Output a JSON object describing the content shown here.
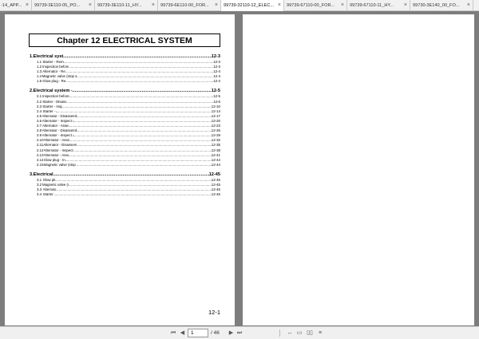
{
  "tabs": [
    {
      "label": "-14_APP...",
      "active": false
    },
    {
      "label": "99739-3E110-05_PO...",
      "active": false
    },
    {
      "label": "99739-3E110-11_HY...",
      "active": false
    },
    {
      "label": "99739-6E110-00_FOR...",
      "active": false
    },
    {
      "label": "99739-32110-12_ELEC...",
      "active": true
    },
    {
      "label": "99739-67110-00_FOR...",
      "active": false
    },
    {
      "label": "99739-67110-11_HY...",
      "active": false
    },
    {
      "label": "99730-3E140_00_FO...",
      "active": false
    }
  ],
  "tab_close_icon": "×",
  "document": {
    "chapter_title": "Chapter 12  ELECTRICAL SYSTEM",
    "footer_page": "12-1",
    "sections": [
      {
        "num": "1.",
        "title": "Electrical system - Remove and Inspect",
        "page": "12-3",
        "items": [
          {
            "num": "1.1",
            "title": "Starter - Remove and Inspect",
            "page": "12-3"
          },
          {
            "num": "1.2",
            "title": "Inspection before removal of alternator",
            "page": "12-3"
          },
          {
            "num": "1.3",
            "title": "Alternator - Remove and Inspect",
            "page": "12-4"
          },
          {
            "num": "1.4",
            "title": "Magnetic valve (stop solenoid) - Remove and Inspect",
            "page": "12-4"
          },
          {
            "num": "1.5",
            "title": "Glow plug - Remove and Inspect",
            "page": "12-4"
          }
        ]
      },
      {
        "num": "2.",
        "title": "Electrical system - Disassemble, Inspect and Assemble",
        "page": "12-5",
        "items": [
          {
            "num": "2.1",
            "title": "Inspection before disassembling starter",
            "page": "12-5"
          },
          {
            "num": "2.2",
            "title": "Starter - Disassemble and Inspect",
            "page": "12-6"
          },
          {
            "num": "2.3",
            "title": "Starter - Inspect and Repair",
            "page": "12-10"
          },
          {
            "num": "2.4",
            "title": "Starter - Assemble",
            "page": "12-14"
          },
          {
            "num": "2.5",
            "title": "Alternator - Disassemble and Inspect (A007TA0483A)",
            "page": "12-17"
          },
          {
            "num": "2.6",
            "title": "Alternator - Inspect and Repair (A007TA0483A)",
            "page": "12-20"
          },
          {
            "num": "2.7",
            "title": "Alternator - Assemble (A007TA0483A)",
            "page": "12-23"
          },
          {
            "num": "2.8",
            "title": "Alternator - Disassemble and Inspect (A005TA5083A)",
            "page": "12-26"
          },
          {
            "num": "2.9",
            "title": "Alternator - Inspect and Repair (A005TA5083A)",
            "page": "12-29"
          },
          {
            "num": "2.10",
            "title": "Alternator - Assemble (A005TA5083A)",
            "page": "12-32"
          },
          {
            "num": "2.11",
            "title": "Alternator - Disassemble and Inspect (A002TA7871)",
            "page": "12-35"
          },
          {
            "num": "2.12",
            "title": "Alternator - Inspect and Repair (A002TA7871)",
            "page": "12-38"
          },
          {
            "num": "2.13",
            "title": "Alternator - Assemble (A002TA7871)",
            "page": "12-41"
          },
          {
            "num": "2.14",
            "title": "Glow plug - Inspect and Repair",
            "page": "12-44"
          },
          {
            "num": "2.15",
            "title": "Magnetic valve (stop solenoid) - Inspect and Repair",
            "page": "12-44"
          }
        ]
      },
      {
        "num": "3.",
        "title": "Electrical system - Install",
        "page": "12-45",
        "items": [
          {
            "num": "3.1",
            "title": "Glow plug - Install",
            "page": "12-45"
          },
          {
            "num": "3.2",
            "title": "Magnetic valve (stop solenoid) - Install",
            "page": "12-45"
          },
          {
            "num": "3.3",
            "title": "Alternator - Install",
            "page": "12-46"
          },
          {
            "num": "3.4",
            "title": "Starter - Install",
            "page": "12-46"
          }
        ]
      }
    ]
  },
  "statusbar": {
    "first_page_icon": "⏮",
    "prev_page_icon": "◀",
    "current_page": "1",
    "total_pages": "/ 46",
    "next_page_icon": "▶",
    "last_page_icon": "⏭",
    "fit_width_icon": "↔",
    "fit_page_icon": "▭",
    "two_page_icon": "▯▯",
    "scroll_icon": "≡"
  }
}
